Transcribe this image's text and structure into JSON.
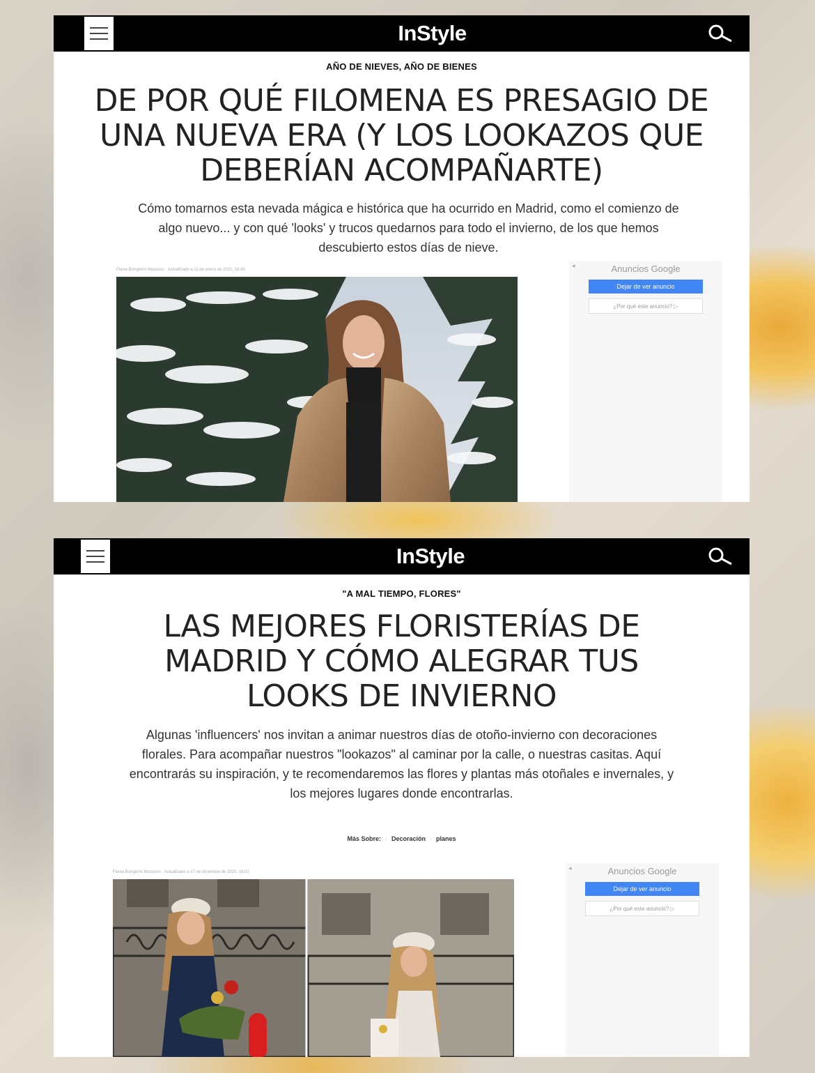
{
  "article1": {
    "logo": "InStyle",
    "kicker": "AÑO DE NIEVES, AÑO DE BIENES",
    "headline": "DE POR QUÉ FILOMENA ES PRESAGIO DE UNA NUEVA ERA (Y LOS LOOKAZOS QUE DEBERÍAN ACOMPAÑARTE)",
    "dek": "Cómo tomarnos esta nevada mágica e histórica que ha ocurrido en Madrid, como el comienzo de algo nuevo... y con qué 'looks' y trucos quedarnos para todo el invierno, de los que hemos descubierto estos días de nieve.",
    "byline": "Flavia Bongiorni Mussoco · Actualizado a 11 de enero de 2021, 18:45",
    "ad": {
      "label": "Anuncios Google",
      "stop_button": "Dejar de ver anuncio",
      "why_button": "¿Por qué este anuncio? ▷"
    }
  },
  "article2": {
    "logo": "InStyle",
    "kicker": "\"A MAL TIEMPO, FLORES\"",
    "headline": "LAS MEJORES FLORISTERÍAS DE MADRID Y CÓMO ALEGRAR TUS LOOKS DE INVIERNO",
    "dek": "Algunas 'influencers' nos invitan a animar nuestros días de otoño-invierno con decoraciones florales. Para acompañar nuestros \"lookazos\" al caminar por la calle, o nuestras casitas. Aquí encontrarás su inspiración, y te recomendaremos las flores y plantas más otoñales e invernales, y los mejores lugares donde encontrarlas.",
    "tags": {
      "label": "Más Sobre:",
      "items": [
        "Decoración",
        "planes"
      ]
    },
    "byline": "Flavia Bongiorni Mussoco · Actualizado a 17 de diciembre de 2020, 16:02",
    "ad": {
      "label": "Anuncios Google",
      "stop_button": "Dejar de ver anuncio",
      "why_button": "¿Por qué este anuncio? ▷"
    }
  },
  "colors": {
    "bar": "#000000",
    "ad_button": "#4285f4"
  }
}
